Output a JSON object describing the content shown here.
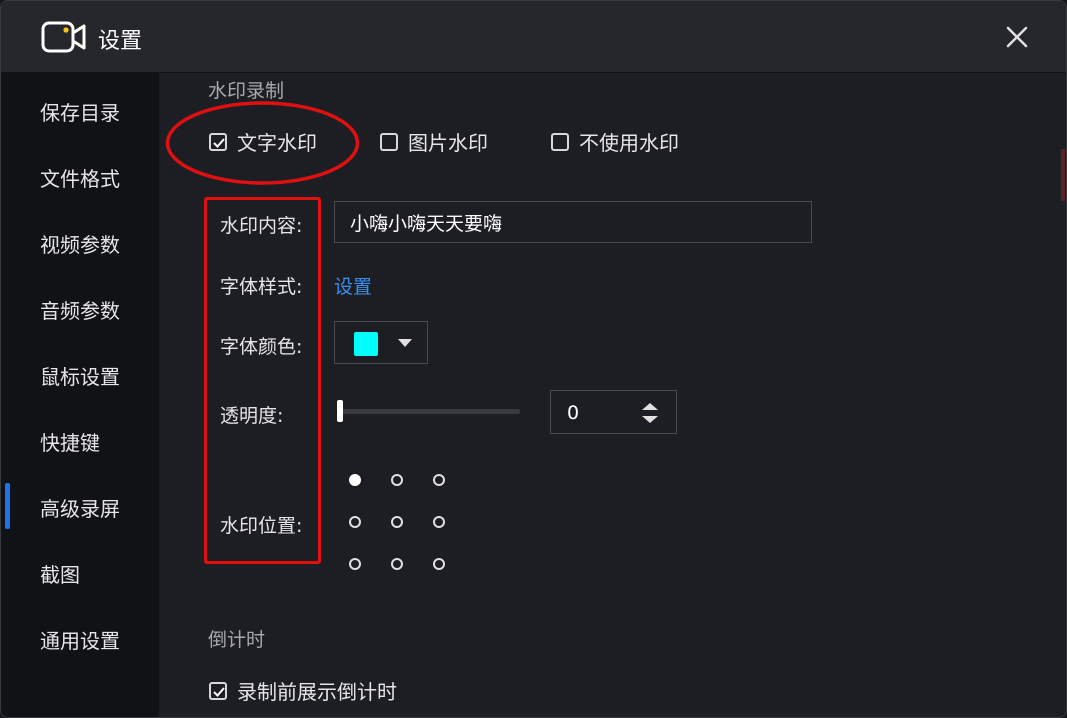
{
  "window": {
    "title": "设置",
    "icons": {
      "app": "video-camera-icon",
      "close": "close-icon"
    }
  },
  "sidebar": {
    "active_index": 6,
    "accent_color": "#1e74e6",
    "items": [
      {
        "label": "保存目录"
      },
      {
        "label": "文件格式"
      },
      {
        "label": "视频参数"
      },
      {
        "label": "音频参数"
      },
      {
        "label": "鼠标设置"
      },
      {
        "label": "快捷键"
      },
      {
        "label": "高级录屏"
      },
      {
        "label": "截图"
      },
      {
        "label": "通用设置"
      }
    ]
  },
  "watermark": {
    "section_title": "水印录制",
    "options": {
      "text": {
        "label": "文字水印",
        "checked": true
      },
      "image": {
        "label": "图片水印",
        "checked": false
      },
      "none": {
        "label": "不使用水印",
        "checked": false
      }
    },
    "content": {
      "label": "水印内容:",
      "value": "小嗨小嗨天天要嗨"
    },
    "font_style": {
      "label": "字体样式:",
      "link": "设置"
    },
    "font_color": {
      "label": "字体颜色:",
      "value": "#00ffff",
      "icon": "dropdown-caret-icon"
    },
    "opacity": {
      "label": "透明度:",
      "value": "0",
      "slider_fraction": 0,
      "icon": "spin-arrows-icon"
    },
    "position": {
      "label": "水印位置:",
      "selected_row": 0,
      "selected_col": 0,
      "rows": 3,
      "cols": 3
    }
  },
  "countdown": {
    "section_title": "倒计时",
    "option": {
      "label": "录制前展示倒计时",
      "checked": true
    }
  },
  "annotation_color": "#e01010"
}
